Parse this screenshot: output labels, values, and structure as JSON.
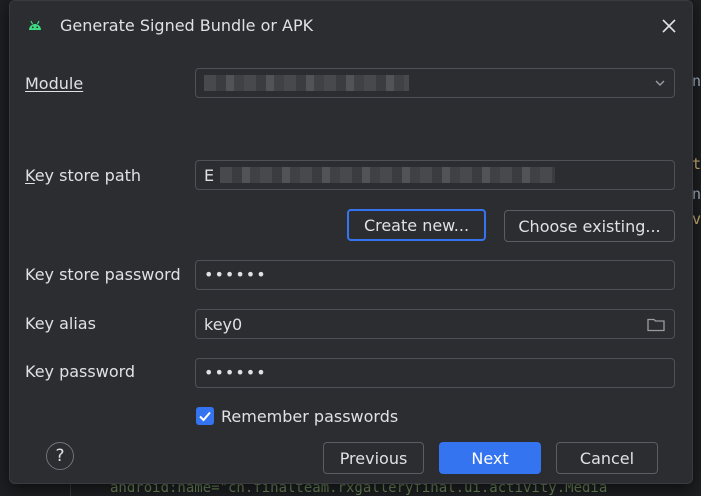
{
  "dialog": {
    "title": "Generate Signed Bundle or APK",
    "module": {
      "label": "Module",
      "value": ""
    },
    "keystore_path": {
      "label": "Key store path",
      "value": "E"
    },
    "create_new": "Create new...",
    "choose_existing": "Choose existing...",
    "keystore_password": {
      "label": "Key store password",
      "value": "••••••"
    },
    "key_alias": {
      "label": "Key alias",
      "value": "key0"
    },
    "key_password": {
      "label": "Key password",
      "value": "••••••"
    },
    "remember": {
      "label": "Remember passwords",
      "checked": true
    },
    "help": "?",
    "previous": "Previous",
    "next": "Next",
    "cancel": "Cancel"
  },
  "background": {
    "code_snippet": "android:name=\"cn.finalteam.rxgalleryfinal.ui.activity.Media",
    "right_snippets": [
      "n",
      "t",
      "n",
      "v"
    ]
  },
  "colors": {
    "accent": "#3574f0",
    "dialog_bg": "#2b2d30",
    "text": "#dfe1e5"
  }
}
